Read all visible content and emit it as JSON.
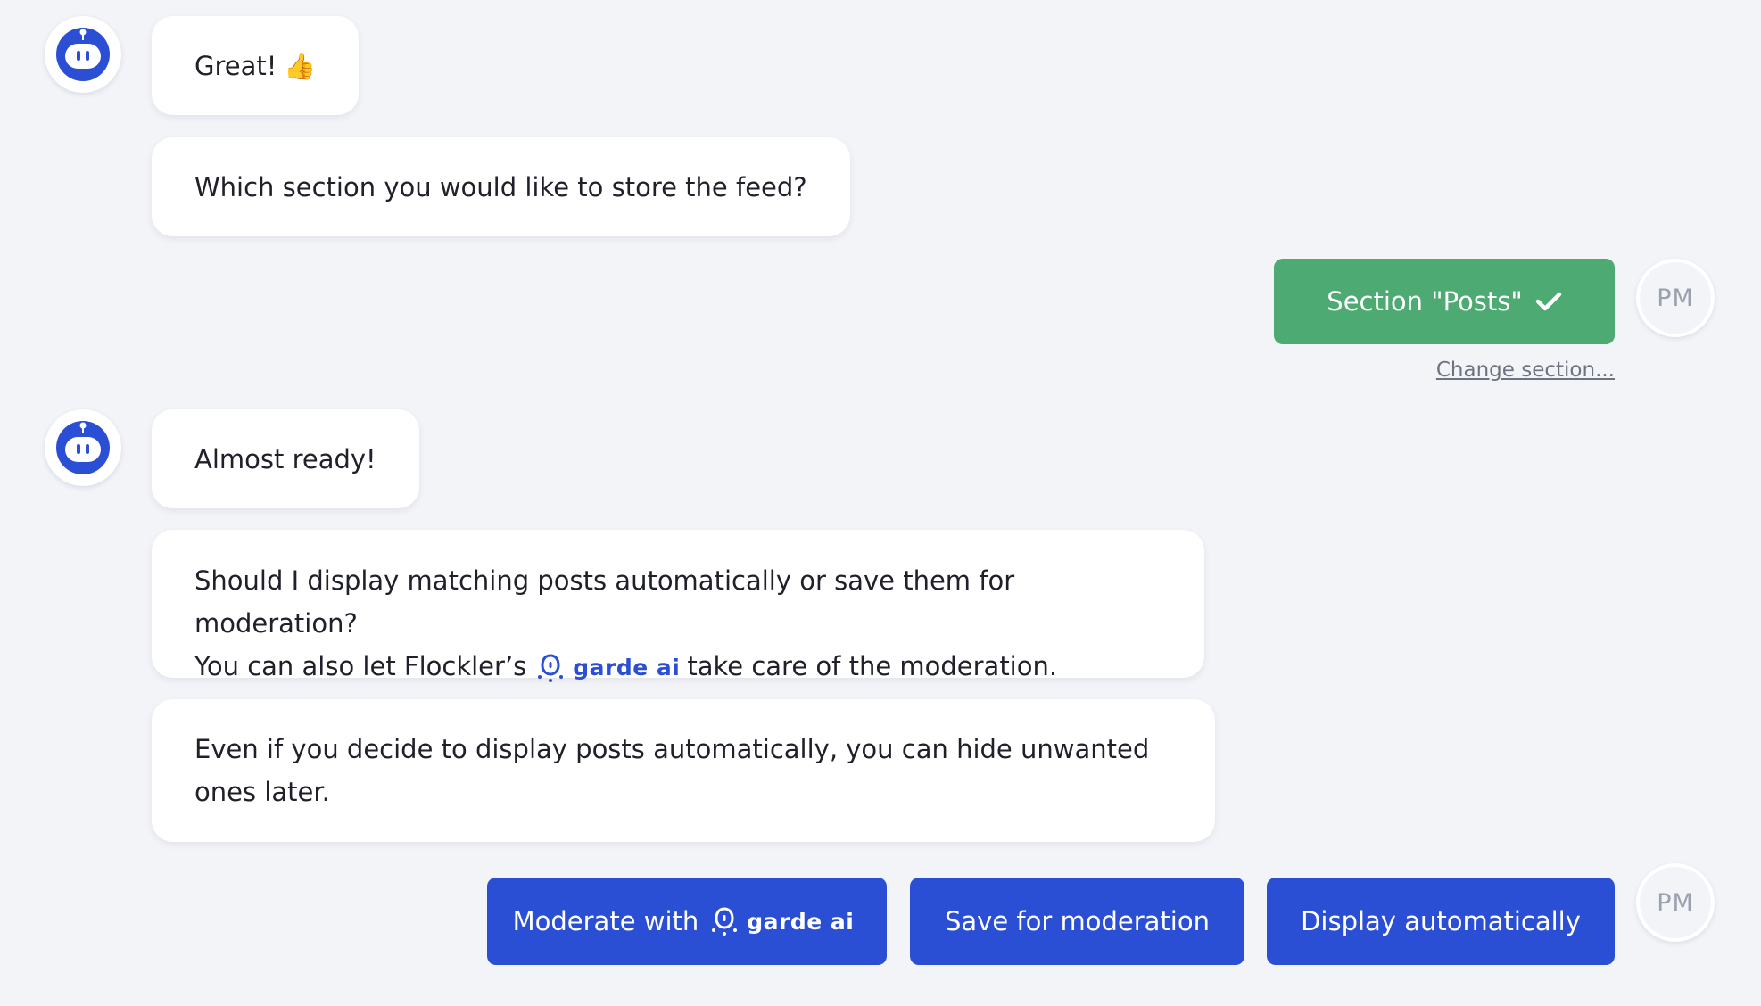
{
  "messages": {
    "greeting": "Great!",
    "greeting_emoji": "👍",
    "question_section": "Which section you would like to store the feed?",
    "almost_ready": "Almost ready!",
    "moderation_line1": "Should I display matching posts automatically or save them for moderation?",
    "moderation_line2_pre": "You can also let Flockler’s",
    "moderation_line2_post": "take care of the moderation.",
    "hide_note": "Even if you decide to display posts automatically, you can hide unwanted ones later."
  },
  "brand": {
    "garde_ai": "garde ai",
    "icon": "garde-ai-logo-icon"
  },
  "user": {
    "initials": "PM"
  },
  "answer": {
    "section_label": "Section \"Posts\"",
    "change_link": "Change section..."
  },
  "choices": {
    "moderate_prefix": "Moderate with",
    "save_for_moderation": "Save for moderation",
    "display_automatically": "Display automatically"
  },
  "colors": {
    "bot_blue": "#2b4fd4",
    "answer_green": "#4caa72",
    "background": "#f3f4f8"
  }
}
